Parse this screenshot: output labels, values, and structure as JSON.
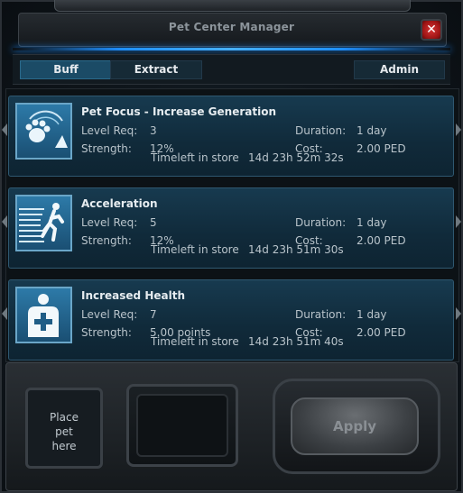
{
  "window": {
    "title": "Pet Center Manager",
    "close_label": "✕"
  },
  "tabs": [
    {
      "label": "Buff",
      "active": true
    },
    {
      "label": "Extract",
      "active": false
    },
    {
      "label": "Admin",
      "active": false
    }
  ],
  "labels": {
    "level_req": "Level Req:",
    "strength": "Strength:",
    "timeleft": "Timeleft in store",
    "duration": "Duration:",
    "cost": "Cost:"
  },
  "buffs": [
    {
      "name": "Pet Focus - Increase Generation",
      "icon": "paw-icon",
      "level_req": "3",
      "strength": "12%",
      "timeleft": "14d 23h 52m 32s",
      "duration": "1 day",
      "cost": "2.00 PED"
    },
    {
      "name": "Acceleration",
      "icon": "running-figure-icon",
      "level_req": "5",
      "strength": "12%",
      "timeleft": "14d 23h 51m 30s",
      "duration": "1 day",
      "cost": "2.00 PED"
    },
    {
      "name": "Increased Health",
      "icon": "health-cross-icon",
      "level_req": "7",
      "strength": "5.00 points",
      "timeleft": "14d 23h 51m 40s",
      "duration": "1 day",
      "cost": "2.00 PED"
    }
  ],
  "bottom": {
    "pet_slot_lines": [
      "Place",
      "pet",
      "here"
    ],
    "apply_label": "Apply"
  },
  "colors": {
    "accent_blue": "#1e8fff",
    "close_red": "#c62828",
    "card_bg": "#173a4f"
  }
}
